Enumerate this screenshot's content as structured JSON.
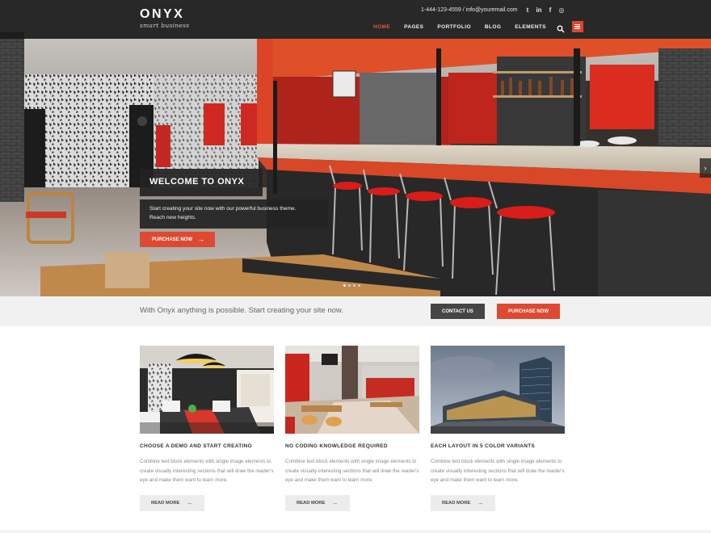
{
  "brand": {
    "name": "ONYX",
    "tagline": "smart business"
  },
  "contact": {
    "phone_email": "1-444-123-4559 / info@youremail.com"
  },
  "social": [
    {
      "icon": "twitter-icon",
      "glyph": "t"
    },
    {
      "icon": "linkedin-icon",
      "glyph": "in"
    },
    {
      "icon": "facebook-icon",
      "glyph": "f"
    },
    {
      "icon": "instagram-icon",
      "glyph": "◎"
    }
  ],
  "nav": {
    "home": "HOME",
    "pages": "PAGES",
    "portfolio": "PORTFOLIO",
    "blog": "BLOG",
    "elements": "ELEMENTS"
  },
  "hero": {
    "title": "WELCOME TO ONYX",
    "desc_line1": "Start creating your site now with our powerful business theme.",
    "desc_line2": "Reach new heights.",
    "button": "PURCHASE NOW",
    "arrow": "→",
    "next": "›"
  },
  "cta": {
    "text": "With Onyx anything is possible. Start creating your site now.",
    "contact": "CONTACT US",
    "purchase": "PURCHASE NOW"
  },
  "features": [
    {
      "title": "CHOOSE A DEMO AND START CREATING",
      "text": "Combine text block elements with single image elements to create visually interesting sections that will draw the reader's eye and make them want to learn more.",
      "button": "READ MORE"
    },
    {
      "title": "NO CODING KNOWLEDGE REQUIRED",
      "text": "Combine text block elements with single image elements to create visually interesting sections that will draw the reader's eye and make them want to learn more.",
      "button": "READ MORE"
    },
    {
      "title": "EACH LAYOUT IN 5 COLOR VARIANTS",
      "text": "Combine text block elements with single image elements to create visually interesting sections that will draw the reader's eye and make them want to learn more.",
      "button": "READ MORE"
    }
  ],
  "colors": {
    "accent": "#dd4a31",
    "dark": "#454545",
    "header": "#1a1a1a"
  },
  "slider": {
    "slides": 4,
    "active": 1
  }
}
